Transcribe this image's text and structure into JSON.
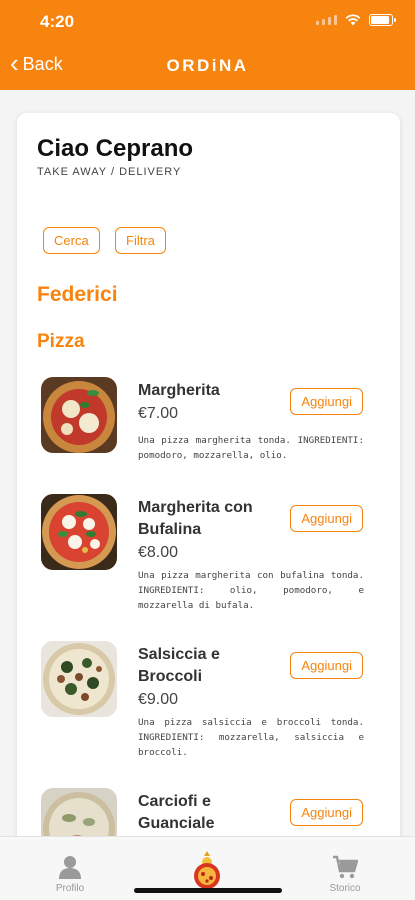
{
  "statusbar": {
    "time": "4:20"
  },
  "header": {
    "back_label": "Back",
    "brand": "ORDiNA"
  },
  "restaurant": {
    "name": "Ciao Ceprano",
    "service_type": "TAKE AWAY / DELIVERY"
  },
  "actions": {
    "search_label": "Cerca",
    "filter_label": "Filtra"
  },
  "section": {
    "title": "Federici"
  },
  "category": {
    "title": "Pizza"
  },
  "add_label": "Aggiungi",
  "products": [
    {
      "name": "Margherita",
      "price": "€7.00",
      "description": "Una pizza margherita tonda. INGREDIENTI: pomodoro, mozzarella, olio."
    },
    {
      "name": "Margherita con Bufalina",
      "price": "€8.00",
      "description": "Una pizza margherita con bufalina tonda. INGREDIENTI: olio, pomodoro, e mozzarella di bufala."
    },
    {
      "name": "Salsiccia e Broccoli",
      "price": "€9.00",
      "description": "Una pizza salsiccia e broccoli tonda. INGREDIENTI: mozzarella, salsiccia e broccoli."
    },
    {
      "name": "Carciofi e Guanciale",
      "price": "",
      "description": ""
    }
  ],
  "tabbar": {
    "profile_label": "Profilo",
    "history_label": "Storico"
  },
  "colors": {
    "accent": "#f7840e"
  }
}
